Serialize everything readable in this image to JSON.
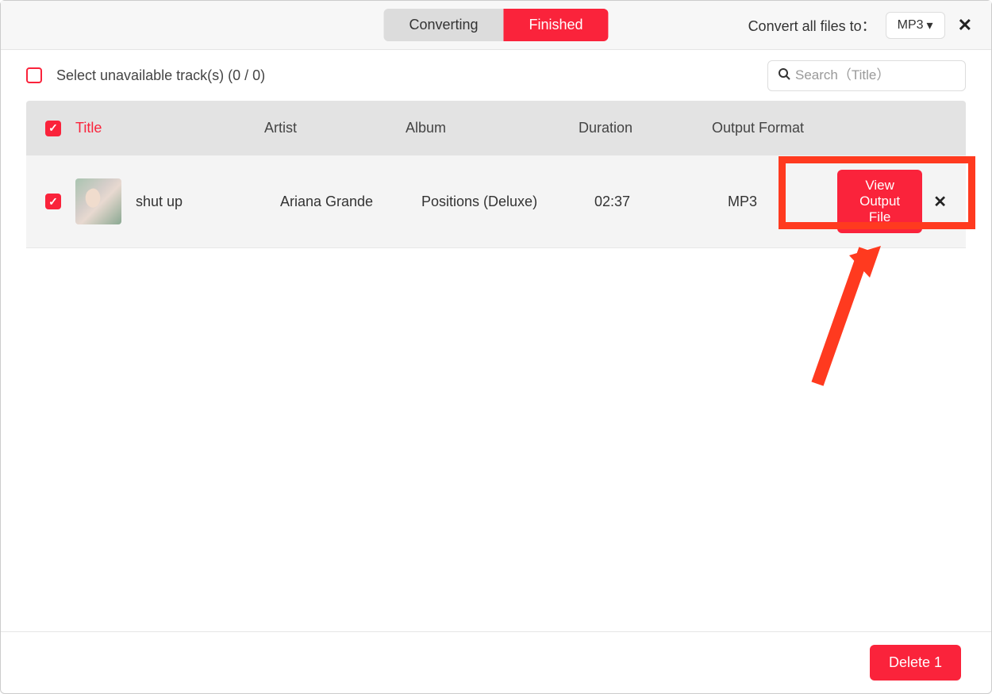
{
  "header": {
    "tabs": {
      "converting": "Converting",
      "finished": "Finished"
    },
    "convert_all_label": "Convert all files to：",
    "format_selected": "MP3"
  },
  "toolbar": {
    "unavailable_label": "Select unavailable track(s) (0 / 0)",
    "search_placeholder": "Search（Title）"
  },
  "columns": {
    "title": "Title",
    "artist": "Artist",
    "album": "Album",
    "duration": "Duration",
    "output_format": "Output Format"
  },
  "tracks": [
    {
      "title": "shut up",
      "artist": "Ariana Grande",
      "album": "Positions (Deluxe)",
      "duration": "02:37",
      "output_format": "MP3",
      "view_btn": "View Output File"
    }
  ],
  "footer": {
    "delete_label": "Delete 1"
  },
  "colors": {
    "accent": "#fa233b",
    "highlight": "#ff3a1f"
  }
}
